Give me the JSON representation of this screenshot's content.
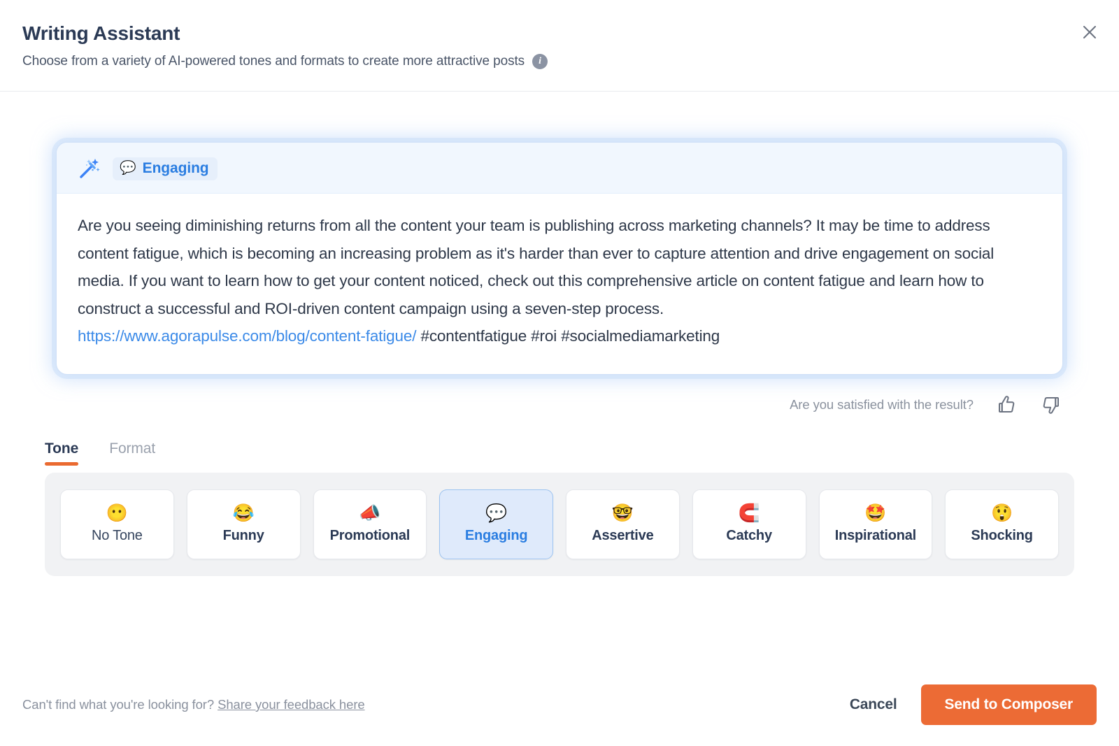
{
  "header": {
    "title": "Writing Assistant",
    "subtitle": "Choose from a variety of AI-powered tones and formats to create more attractive posts",
    "info_icon": "info-icon",
    "close_icon": "close-icon"
  },
  "result": {
    "wand_icon": "magic-wand-icon",
    "badge_emoji": "💬",
    "badge_label": "Engaging",
    "text": "Are you seeing diminishing returns from all the content your team is publishing across marketing channels? It may be time to address content fatigue, which is becoming an increasing problem as it's harder than ever to capture attention and drive engagement on social media. If you want to learn how to get your content noticed, check out this comprehensive article on content fatigue and learn how to construct a successful and ROI-driven content campaign using a seven-step process.",
    "link": "https://www.agorapulse.com/blog/content-fatigue/",
    "hashtags": "#contentfatigue #roi #socialmediamarketing"
  },
  "feedback": {
    "label": "Are you satisfied with the result?",
    "thumbs_up_icon": "thumbs-up-icon",
    "thumbs_down_icon": "thumbs-down-icon"
  },
  "tabs": [
    {
      "label": "Tone",
      "active": true
    },
    {
      "label": "Format",
      "active": false
    }
  ],
  "tones": [
    {
      "label": "No Tone",
      "emoji": "😶",
      "selected": false,
      "plain": true
    },
    {
      "label": "Funny",
      "emoji": "😂",
      "selected": false,
      "plain": false
    },
    {
      "label": "Promotional",
      "emoji": "📣",
      "selected": false,
      "plain": false
    },
    {
      "label": "Engaging",
      "emoji": "💬",
      "selected": true,
      "plain": false
    },
    {
      "label": "Assertive",
      "emoji": "🤓",
      "selected": false,
      "plain": false
    },
    {
      "label": "Catchy",
      "emoji": "🧲",
      "selected": false,
      "plain": false
    },
    {
      "label": "Inspirational",
      "emoji": "🤩",
      "selected": false,
      "plain": false
    },
    {
      "label": "Shocking",
      "emoji": "😲",
      "selected": false,
      "plain": false
    }
  ],
  "footer": {
    "note": "Can't find what you're looking for?",
    "link": "Share your feedback here",
    "cancel_label": "Cancel",
    "primary_label": "Send to Composer"
  },
  "colors": {
    "accent_orange": "#ec6b35",
    "accent_blue": "#2a7de1",
    "title_navy": "#2b3a55",
    "muted_gray": "#8a919e"
  }
}
